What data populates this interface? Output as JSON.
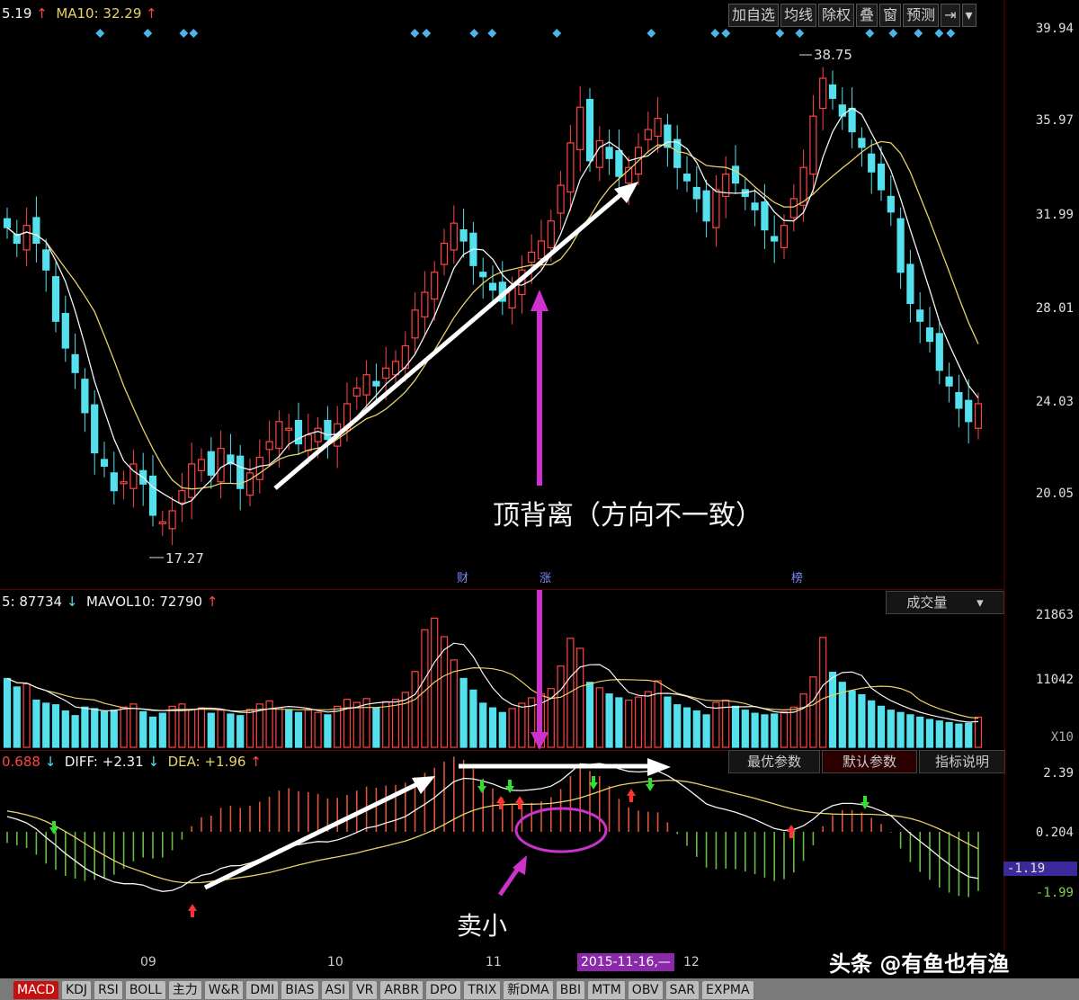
{
  "colors": {
    "up": "#ff4444",
    "down": "#55e0ee",
    "ma5": "#f3f3f3",
    "ma10": "#e8d26a",
    "accent": "#cc33cc",
    "diff": "#f3f3f3",
    "dea": "#e8d26a",
    "macd_up": "#e0553a",
    "macd_down": "#66bb44"
  },
  "price_panel": {
    "ma_prefix": "5.19",
    "ma10_label": "MA10: 32.29",
    "y_ticks": [
      "39.94",
      "35.97",
      "31.99",
      "28.01",
      "24.03",
      "20.05"
    ],
    "high_mark": "38.75",
    "low_mark": "17.27",
    "annotation": "顶背离（方向不一致）",
    "event_marks": [
      "财",
      "涨",
      "榜"
    ]
  },
  "toolbar": {
    "items": [
      "加自选",
      "均线",
      "除权",
      "叠",
      "窗",
      "预测",
      "⇥"
    ],
    "dropdown_icon": "chevron-down-icon"
  },
  "volume_panel": {
    "label_vol5": "5: 87734",
    "label_mavol10": "MAVOL10: 72790",
    "selector": "成交量",
    "y_ticks": [
      "21863",
      "11042",
      "X10"
    ]
  },
  "macd_panel": {
    "label_macd": "0.688",
    "label_diff": "DIFF: +2.31",
    "label_dea": "DEA: +1.96",
    "buttons": [
      "最优参数",
      "默认参数",
      "指标说明"
    ],
    "y_ticks": [
      "2.39",
      "0.204",
      "-1.19",
      "-1.99"
    ],
    "annotation": "卖小"
  },
  "x_axis": {
    "labels": [
      "09",
      "10",
      "11",
      "12"
    ],
    "date_box": "2015-11-16,—"
  },
  "tabs": [
    "MACD",
    "KDJ",
    "RSI",
    "BOLL",
    "主力",
    "W&R",
    "DMI",
    "BIAS",
    "ASI",
    "VR",
    "ARBR",
    "DPO",
    "TRIX",
    "新DMA",
    "BBI",
    "MTM",
    "OBV",
    "SAR",
    "EXPMA"
  ],
  "watermark": "头条 @有鱼也有渔",
  "chart_data": {
    "type": "candlestick",
    "ylim": [
      16.5,
      40.5
    ],
    "close": [
      31.5,
      30.8,
      31.6,
      30.8,
      29.6,
      27.3,
      26.1,
      25.0,
      23.2,
      21.4,
      20.8,
      19.7,
      20.1,
      20.9,
      20.0,
      18.6,
      18.3,
      18.8,
      19.7,
      20.9,
      21.1,
      20.4,
      21.6,
      20.9,
      19.8,
      20.5,
      21.2,
      21.9,
      22.8,
      22.5,
      21.8,
      22.2,
      22.5,
      22.0,
      22.7,
      23.6,
      24.3,
      24.9,
      24.4,
      25.2,
      25.5,
      26.2,
      27.8,
      28.6,
      29.5,
      30.8,
      31.7,
      30.9,
      29.8,
      29.3,
      28.7,
      28.2,
      28.8,
      29.6,
      30.4,
      30.9,
      31.8,
      33.4,
      35.3,
      36.9,
      34.5,
      35.4,
      34.6,
      33.8,
      34.2,
      35.1,
      35.9,
      36.4,
      35.1,
      34.2,
      33.6,
      32.8,
      31.8,
      33.2,
      33.9,
      33.5,
      32.9,
      32.3,
      31.4,
      30.9,
      31.6,
      32.8,
      34.2,
      36.5,
      38.2,
      37.3,
      36.5,
      35.8,
      35.1,
      34.0,
      33.2,
      32.2,
      29.5,
      28.1,
      27.3,
      26.4,
      25.1,
      24.4,
      23.4,
      22.8,
      23.6
    ],
    "vol": [
      8.9,
      7.8,
      8.2,
      6.1,
      5.7,
      5.5,
      4.7,
      4.1,
      5.2,
      5.0,
      4.6,
      4.8,
      5.2,
      5.6,
      4.6,
      3.9,
      4.4,
      5.3,
      5.6,
      4.9,
      5.1,
      4.4,
      4.8,
      4.3,
      4.1,
      4.9,
      5.6,
      6.0,
      5.1,
      4.8,
      4.5,
      4.8,
      4.5,
      4.2,
      5.3,
      6.2,
      5.8,
      6.3,
      5.1,
      5.9,
      6.2,
      7.1,
      9.8,
      15.2,
      16.7,
      14.3,
      11.3,
      8.9,
      7.4,
      5.7,
      5.1,
      4.5,
      5.0,
      5.7,
      6.4,
      6.9,
      7.6,
      10.5,
      14.1,
      12.8,
      8.4,
      7.7,
      6.9,
      6.4,
      6.1,
      6.5,
      7.2,
      8.6,
      6.5,
      5.5,
      5.1,
      4.7,
      4.2,
      5.8,
      6.1,
      5.3,
      4.8,
      4.4,
      4.2,
      4.3,
      4.6,
      5.2,
      6.9,
      9.1,
      14.2,
      9.7,
      8.4,
      7.3,
      6.8,
      6.0,
      5.3,
      4.8,
      4.5,
      4.2,
      3.9,
      3.6,
      3.4,
      3.2,
      3.0,
      3.1,
      3.9
    ],
    "diff": [
      0.55,
      0.45,
      0.32,
      0.1,
      -0.2,
      -0.48,
      -0.78,
      -1.04,
      -1.3,
      -1.5,
      -1.66,
      -1.8,
      -1.86,
      -1.86,
      -1.91,
      -2.05,
      -2.14,
      -2.1,
      -1.96,
      -1.73,
      -1.56,
      -1.49,
      -1.31,
      -1.22,
      -1.21,
      -1.12,
      -0.99,
      -0.83,
      -0.63,
      -0.5,
      -0.46,
      -0.4,
      -0.35,
      -0.36,
      -0.29,
      -0.17,
      -0.02,
      0.14,
      0.2,
      0.32,
      0.42,
      0.55,
      0.77,
      0.99,
      1.23,
      1.52,
      1.8,
      1.92,
      1.9,
      1.82,
      1.72,
      1.58,
      1.49,
      1.48,
      1.51,
      1.55,
      1.64,
      1.84,
      2.13,
      2.44,
      2.42,
      2.45,
      2.39,
      2.26,
      2.17,
      2.15,
      2.17,
      2.18,
      2.02,
      1.8,
      1.55,
      1.28,
      1.0,
      0.88,
      0.8,
      0.7,
      0.58,
      0.44,
      0.28,
      0.12,
      0.05,
      0.08,
      0.22,
      0.45,
      0.76,
      0.94,
      1.02,
      1.02,
      0.98,
      0.88,
      0.75,
      0.58,
      0.25,
      -0.06,
      -0.34,
      -0.61,
      -0.9,
      -1.16,
      -1.4,
      -1.61,
      -1.67
    ],
    "dea": [
      0.75,
      0.69,
      0.61,
      0.51,
      0.37,
      0.2,
      0.01,
      -0.2,
      -0.42,
      -0.64,
      -0.84,
      -1.03,
      -1.2,
      -1.33,
      -1.45,
      -1.57,
      -1.68,
      -1.77,
      -1.82,
      -1.83,
      -1.82,
      -1.78,
      -1.74,
      -1.69,
      -1.64,
      -1.59,
      -1.53,
      -1.46,
      -1.37,
      -1.28,
      -1.19,
      -1.11,
      -1.03,
      -0.96,
      -0.9,
      -0.83,
      -0.76,
      -0.67,
      -0.59,
      -0.51,
      -0.42,
      -0.33,
      -0.21,
      -0.07,
      0.08,
      0.26,
      0.45,
      0.63,
      0.77,
      0.87,
      0.94,
      0.97,
      0.99,
      0.99,
      0.99,
      1.0,
      1.02,
      1.07,
      1.13,
      1.22,
      1.33,
      1.45,
      1.57,
      1.67,
      1.73,
      1.77,
      1.81,
      1.83,
      1.85,
      1.84,
      1.8,
      1.73,
      1.64,
      1.55,
      1.46,
      1.37,
      1.29,
      1.2,
      1.1,
      1.0,
      0.9,
      0.81,
      0.74,
      0.69,
      0.66,
      0.64,
      0.63,
      0.63,
      0.63,
      0.63,
      0.61,
      0.59,
      0.55,
      0.48,
      0.38,
      0.25,
      0.1,
      -0.07,
      -0.25,
      -0.44,
      -0.61
    ]
  }
}
